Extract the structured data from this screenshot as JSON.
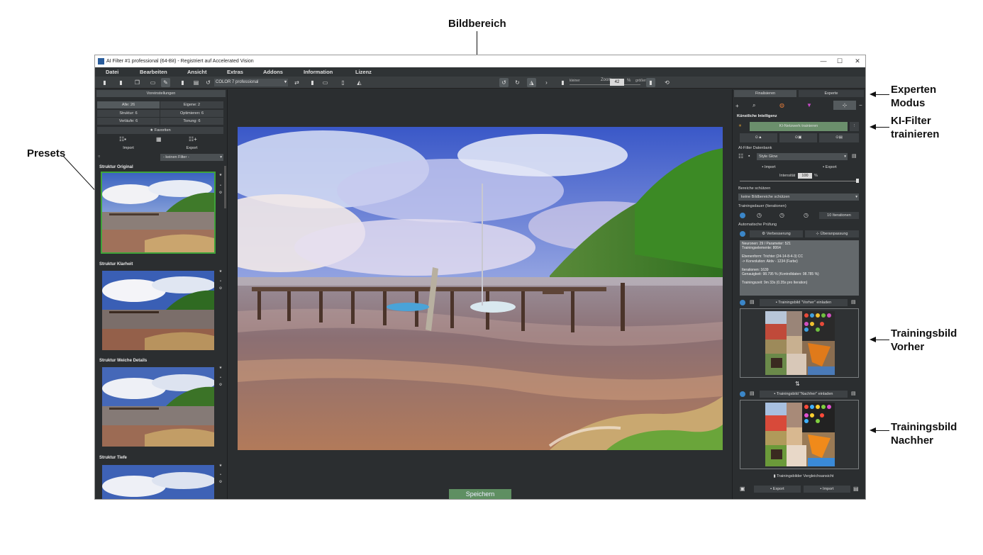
{
  "annotations": {
    "image_area": "Bildbereich",
    "expert_mode_line1": "Experten",
    "expert_mode_line2": "Modus",
    "ai_train_line1": "KI-Filter",
    "ai_train_line2": "trainieren",
    "presets": "Presets",
    "train_before_line1": "Trainingsbild",
    "train_before_line2": "Vorher",
    "train_after_line1": "Trainingsbild",
    "train_after_line2": "Nachher"
  },
  "window": {
    "title": "AI Filter #1 professional (64-Bit) - Registriert auf Accelerated Vision",
    "controls": [
      "—",
      "☐",
      "✕"
    ]
  },
  "menu": [
    "Datei",
    "Bearbeiten",
    "Ansicht",
    "Extras",
    "Addons",
    "Information",
    "Lizenz"
  ],
  "toolbar": {
    "preset": "COLOR 7 professional",
    "zoom_label": "Zoom",
    "zoom_value": "42",
    "zoom_unit": "%",
    "smaller": "kleiner",
    "larger": "größer"
  },
  "left": {
    "header": "Voreinstellungen",
    "filters": [
      "Alle: 26",
      "Eigene: 2",
      "Struktur: 6",
      "Optimieren: 6",
      "Verläufe: 6",
      "Tonung: 6"
    ],
    "favorites": "★ Favoriten",
    "import": "Import",
    "export": "Export",
    "no_filter": "- keinen Filter -",
    "sections": [
      "Struktur Original",
      "Struktur Klarheit",
      "Struktur Weiche Details",
      "Struktur Tiefe"
    ]
  },
  "center": {
    "save": "Speichern"
  },
  "right": {
    "tab_finalize": "Finalisieren",
    "tab_expert": "Experte",
    "ai_title": "Künstliche Intelligenz",
    "train_network": "KI-Netzwerk trainieren",
    "db_title": "AI-Filter Datenbank",
    "db_value": "Style Glow",
    "import": "Import",
    "export": "Export",
    "intensity_label": "Intensität",
    "intensity_value": "100",
    "intensity_unit": "%",
    "protect_title": "Bereiche schützen",
    "protect_value": "keine Bildbereiche schützen",
    "duration_title": "Trainingsdauer (Iterationen)",
    "iterations": "10 Iterationen",
    "auto_check": "Automatische Prüfung",
    "improve": "Verbesserung",
    "fit": "Überanpassung",
    "info_lines": [
      "Neuronen: 29 / Parameter: 521",
      "Trainingselemente: 8064",
      "",
      "Ebenenform: Trichter (24-14-8-4-3) CC",
      "-> Konvolution: Aktiv - 1234 (Farbe)",
      "",
      "Iterationen: 1639",
      "Genauigkeit: 98.795 % (Kontrolldaten: 98.785 %)",
      "",
      "Trainingszeit: 9m 33s (0.35s pro Iteration)"
    ],
    "load_before": "Trainingsbild \"Vorher\" einladen",
    "load_after": "Trainingsbild \"Nachher\" einladen",
    "compare": "Trainingsbilder Vergleichsansicht",
    "bottom_export": "Export",
    "bottom_import": "Import"
  }
}
